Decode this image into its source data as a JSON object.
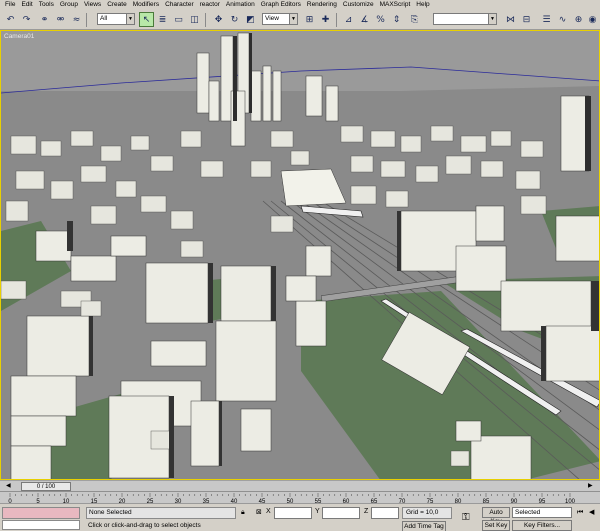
{
  "menu": [
    "File",
    "Edit",
    "Tools",
    "Group",
    "Views",
    "Create",
    "Modifiers",
    "Character",
    "reactor",
    "Animation",
    "Graph Editors",
    "Rendering",
    "Customize",
    "MAXScript",
    "Help"
  ],
  "toolbar": {
    "selection_filter": "All",
    "ref_coord": "View",
    "named_selection": ""
  },
  "viewport": {
    "label": "Camera01"
  },
  "timeline": {
    "frame_display": "0 / 100",
    "ticks": [
      "0",
      "5",
      "10",
      "15",
      "20",
      "25",
      "30",
      "35",
      "40",
      "45",
      "50",
      "55",
      "60",
      "65",
      "70",
      "75",
      "80",
      "85",
      "90",
      "95",
      "100"
    ]
  },
  "status": {
    "selection": "None Selected",
    "prompt": "Click or click-and-drag to select objects",
    "x_label": "X",
    "y_label": "Y",
    "z_label": "Z",
    "grid": "Grid = 10,0",
    "add_time_tag": "Add Time Tag",
    "auto_key": "Auto Key",
    "set_key": "Set Key",
    "key_mode": "Selected",
    "key_filters": "Key Filters..."
  },
  "colors": {
    "viewport_border": "#e8d000",
    "ground": "#8a8a8a",
    "grass": "#5f7a58",
    "building": "#e8e8e0",
    "active_tool": "#b8e8a8",
    "maxscript": "#e8b8c0"
  }
}
